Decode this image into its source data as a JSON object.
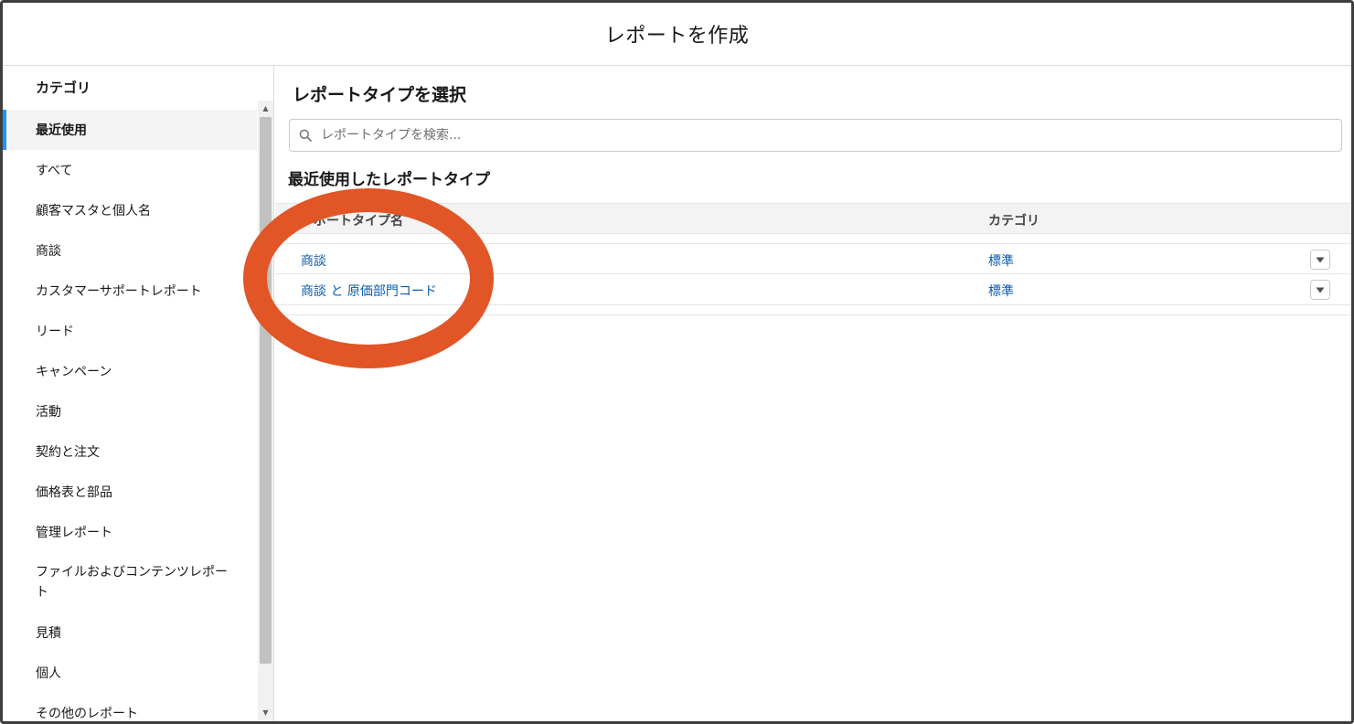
{
  "modal": {
    "title": "レポートを作成"
  },
  "sidebar": {
    "heading": "カテゴリ",
    "items": [
      {
        "label": "最近使用"
      },
      {
        "label": "すべて"
      },
      {
        "label": "顧客マスタと個人名"
      },
      {
        "label": "商談"
      },
      {
        "label": "カスタマーサポートレポート"
      },
      {
        "label": "リード"
      },
      {
        "label": "キャンペーン"
      },
      {
        "label": "活動"
      },
      {
        "label": "契約と注文"
      },
      {
        "label": "価格表と部品"
      },
      {
        "label": "管理レポート"
      },
      {
        "label": "ファイルおよびコンテンツレポート"
      },
      {
        "label": "見積"
      },
      {
        "label": "個人"
      },
      {
        "label": "その他のレポート"
      }
    ],
    "active_index": 0
  },
  "main": {
    "title": "レポートタイプを選択",
    "search": {
      "placeholder": "レポートタイプを検索..."
    },
    "section_title": "最近使用したレポートタイプ",
    "table": {
      "columns": [
        "レポートタイプ名",
        "カテゴリ"
      ],
      "rows": [
        {
          "name": "商談",
          "category": "標準"
        },
        {
          "name": "商談 と 原価部門コード",
          "category": "標準"
        }
      ]
    }
  },
  "colors": {
    "accent": "#1b96ff",
    "link": "#0b5cab",
    "highlight": "#e15526"
  }
}
